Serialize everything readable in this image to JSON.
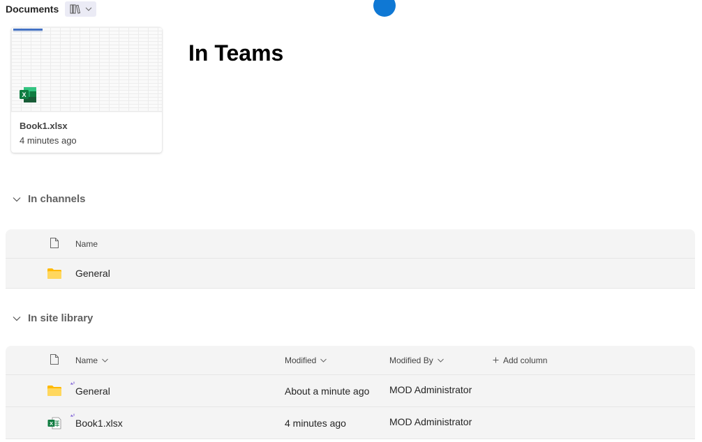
{
  "header": {
    "title": "Documents",
    "view_switch_icon": "library-icon",
    "view_switch_chevron": "chevron-down-icon"
  },
  "page_title": "In Teams",
  "recent_card": {
    "file_name": "Book1.xlsx",
    "modified": "4 minutes ago",
    "icon": "excel-icon"
  },
  "colors": {
    "accent": "#0f78d4",
    "excel_green": "#107c41",
    "folder_yellow": "#ffc83d",
    "table_bg": "#f4f4f4"
  },
  "sections": {
    "channels": {
      "label": "In channels",
      "columns": {
        "icon": "file-icon",
        "name": "Name"
      },
      "rows": [
        {
          "icon": "folder-icon",
          "name": "General"
        }
      ]
    },
    "site_library": {
      "label": "In site library",
      "columns": {
        "icon": "file-icon",
        "name": "Name",
        "modified": "Modified",
        "modified_by": "Modified By",
        "add_column": "Add column"
      },
      "rows": [
        {
          "icon": "folder-icon",
          "name": "General",
          "modified": "About a minute ago",
          "modified_by": "MOD Administrator",
          "new_indicator": true
        },
        {
          "icon": "excel-file-icon",
          "name": "Book1.xlsx",
          "modified": "4 minutes ago",
          "modified_by": "MOD Administrator",
          "new_indicator": true
        }
      ]
    }
  }
}
